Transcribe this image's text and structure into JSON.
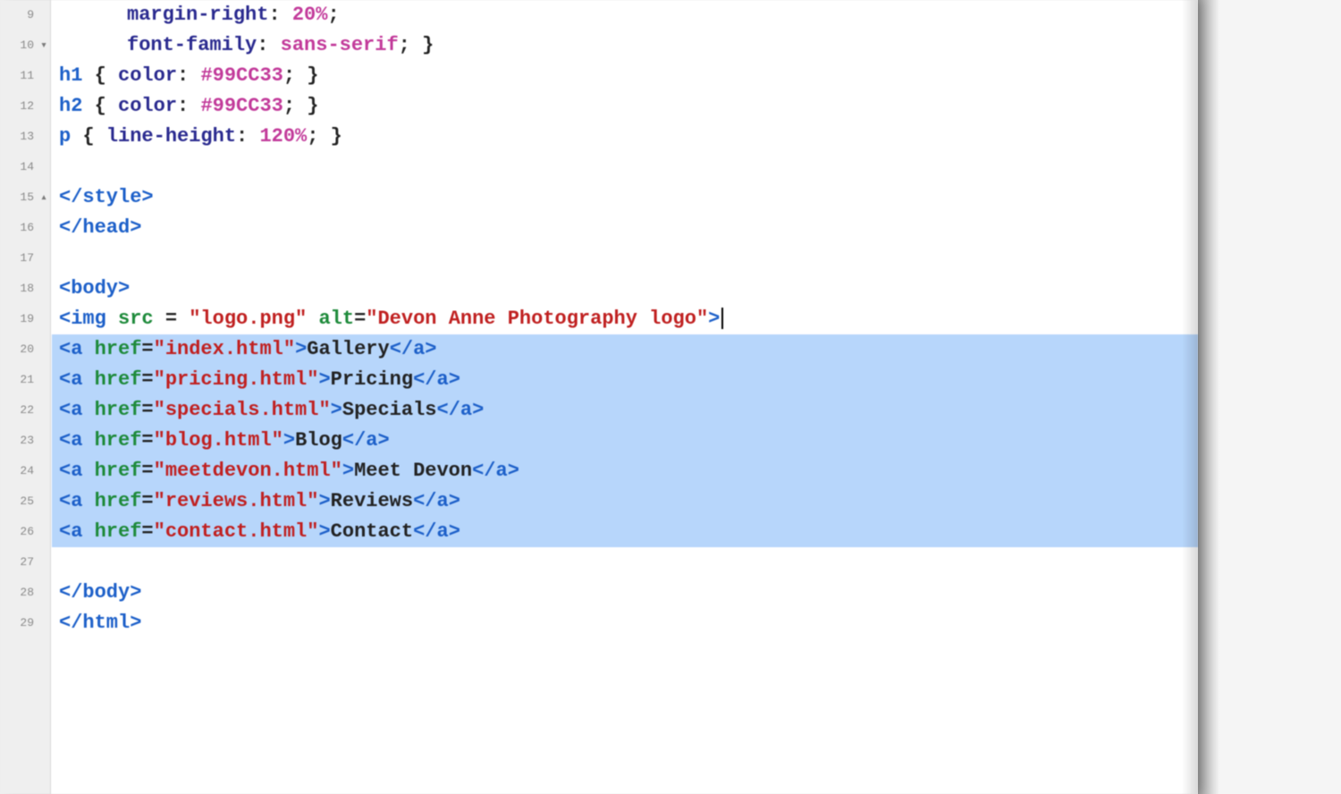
{
  "editor": {
    "first_line_number": 9,
    "fold_markers": {
      "10": "▾",
      "15": "▴"
    },
    "selection_start": 20,
    "selection_end": 26,
    "cursor_line": 19,
    "lines": [
      {
        "n": 9,
        "indent": 1,
        "tokens": [
          {
            "cls": "tok-prop",
            "t": "margin-right"
          },
          {
            "cls": "tok-plain",
            "t": ": "
          },
          {
            "cls": "tok-val",
            "t": "20%"
          },
          {
            "cls": "tok-plain",
            "t": ";"
          }
        ]
      },
      {
        "n": 10,
        "indent": 1,
        "tokens": [
          {
            "cls": "tok-prop",
            "t": "font-family"
          },
          {
            "cls": "tok-plain",
            "t": ": "
          },
          {
            "cls": "tok-val",
            "t": "sans-serif"
          },
          {
            "cls": "tok-plain",
            "t": "; }"
          }
        ]
      },
      {
        "n": 11,
        "indent": 0,
        "tokens": [
          {
            "cls": "tok-tag",
            "t": "h1"
          },
          {
            "cls": "tok-plain",
            "t": " { "
          },
          {
            "cls": "tok-prop",
            "t": "color"
          },
          {
            "cls": "tok-plain",
            "t": ": "
          },
          {
            "cls": "tok-val",
            "t": "#99CC33"
          },
          {
            "cls": "tok-plain",
            "t": "; }"
          }
        ]
      },
      {
        "n": 12,
        "indent": 0,
        "tokens": [
          {
            "cls": "tok-tag",
            "t": "h2"
          },
          {
            "cls": "tok-plain",
            "t": " { "
          },
          {
            "cls": "tok-prop",
            "t": "color"
          },
          {
            "cls": "tok-plain",
            "t": ": "
          },
          {
            "cls": "tok-val",
            "t": "#99CC33"
          },
          {
            "cls": "tok-plain",
            "t": "; }"
          }
        ]
      },
      {
        "n": 13,
        "indent": 0,
        "tokens": [
          {
            "cls": "tok-tag",
            "t": "p"
          },
          {
            "cls": "tok-plain",
            "t": " { "
          },
          {
            "cls": "tok-prop",
            "t": "line-height"
          },
          {
            "cls": "tok-plain",
            "t": ": "
          },
          {
            "cls": "tok-val",
            "t": "120%"
          },
          {
            "cls": "tok-plain",
            "t": "; }"
          }
        ]
      },
      {
        "n": 14,
        "indent": 0,
        "tokens": []
      },
      {
        "n": 15,
        "indent": 0,
        "tokens": [
          {
            "cls": "tok-tag",
            "t": "</style>"
          }
        ]
      },
      {
        "n": 16,
        "indent": 0,
        "tokens": [
          {
            "cls": "tok-tag",
            "t": "</head>"
          }
        ]
      },
      {
        "n": 17,
        "indent": 0,
        "tokens": []
      },
      {
        "n": 18,
        "indent": 0,
        "tokens": [
          {
            "cls": "tok-tag",
            "t": "<body>"
          }
        ]
      },
      {
        "n": 19,
        "indent": 0,
        "cursor_after": true,
        "tokens": [
          {
            "cls": "tok-tag",
            "t": "<img "
          },
          {
            "cls": "tok-attr",
            "t": "src"
          },
          {
            "cls": "tok-plain",
            "t": " = "
          },
          {
            "cls": "tok-str",
            "t": "\"logo.png\""
          },
          {
            "cls": "tok-plain",
            "t": " "
          },
          {
            "cls": "tok-attr",
            "t": "alt"
          },
          {
            "cls": "tok-plain",
            "t": "="
          },
          {
            "cls": "tok-str",
            "t": "\"Devon Anne Photography logo\""
          },
          {
            "cls": "tok-tag",
            "t": ">"
          }
        ]
      },
      {
        "n": 20,
        "indent": 0,
        "tokens": [
          {
            "cls": "tok-tag",
            "t": "<a "
          },
          {
            "cls": "tok-attr",
            "t": "href"
          },
          {
            "cls": "tok-plain",
            "t": "="
          },
          {
            "cls": "tok-str",
            "t": "\"index.html\""
          },
          {
            "cls": "tok-tag",
            "t": ">"
          },
          {
            "cls": "tok-plain",
            "t": "Gallery"
          },
          {
            "cls": "tok-tag",
            "t": "</a>"
          }
        ]
      },
      {
        "n": 21,
        "indent": 0,
        "tokens": [
          {
            "cls": "tok-tag",
            "t": "<a "
          },
          {
            "cls": "tok-attr",
            "t": "href"
          },
          {
            "cls": "tok-plain",
            "t": "="
          },
          {
            "cls": "tok-str",
            "t": "\"pricing.html\""
          },
          {
            "cls": "tok-tag",
            "t": ">"
          },
          {
            "cls": "tok-plain",
            "t": "Pricing"
          },
          {
            "cls": "tok-tag",
            "t": "</a>"
          }
        ]
      },
      {
        "n": 22,
        "indent": 0,
        "tokens": [
          {
            "cls": "tok-tag",
            "t": "<a "
          },
          {
            "cls": "tok-attr",
            "t": "href"
          },
          {
            "cls": "tok-plain",
            "t": "="
          },
          {
            "cls": "tok-str",
            "t": "\"specials.html\""
          },
          {
            "cls": "tok-tag",
            "t": ">"
          },
          {
            "cls": "tok-plain",
            "t": "Specials"
          },
          {
            "cls": "tok-tag",
            "t": "</a>"
          }
        ]
      },
      {
        "n": 23,
        "indent": 0,
        "tokens": [
          {
            "cls": "tok-tag",
            "t": "<a "
          },
          {
            "cls": "tok-attr",
            "t": "href"
          },
          {
            "cls": "tok-plain",
            "t": "="
          },
          {
            "cls": "tok-str",
            "t": "\"blog.html\""
          },
          {
            "cls": "tok-tag",
            "t": ">"
          },
          {
            "cls": "tok-plain",
            "t": "Blog"
          },
          {
            "cls": "tok-tag",
            "t": "</a>"
          }
        ]
      },
      {
        "n": 24,
        "indent": 0,
        "tokens": [
          {
            "cls": "tok-tag",
            "t": "<a "
          },
          {
            "cls": "tok-attr",
            "t": "href"
          },
          {
            "cls": "tok-plain",
            "t": "="
          },
          {
            "cls": "tok-str",
            "t": "\"meetdevon.html\""
          },
          {
            "cls": "tok-tag",
            "t": ">"
          },
          {
            "cls": "tok-plain",
            "t": "Meet Devon"
          },
          {
            "cls": "tok-tag",
            "t": "</a>"
          }
        ]
      },
      {
        "n": 25,
        "indent": 0,
        "tokens": [
          {
            "cls": "tok-tag",
            "t": "<a "
          },
          {
            "cls": "tok-attr",
            "t": "href"
          },
          {
            "cls": "tok-plain",
            "t": "="
          },
          {
            "cls": "tok-str",
            "t": "\"reviews.html\""
          },
          {
            "cls": "tok-tag",
            "t": ">"
          },
          {
            "cls": "tok-plain",
            "t": "Reviews"
          },
          {
            "cls": "tok-tag",
            "t": "</a>"
          }
        ]
      },
      {
        "n": 26,
        "indent": 0,
        "tokens": [
          {
            "cls": "tok-tag",
            "t": "<a "
          },
          {
            "cls": "tok-attr",
            "t": "href"
          },
          {
            "cls": "tok-plain",
            "t": "="
          },
          {
            "cls": "tok-str",
            "t": "\"contact.html\""
          },
          {
            "cls": "tok-tag",
            "t": ">"
          },
          {
            "cls": "tok-plain",
            "t": "Contact"
          },
          {
            "cls": "tok-tag",
            "t": "</a>"
          }
        ]
      },
      {
        "n": 27,
        "indent": 0,
        "tokens": []
      },
      {
        "n": 28,
        "indent": 0,
        "tokens": [
          {
            "cls": "tok-tag",
            "t": "</body>"
          }
        ]
      },
      {
        "n": 29,
        "indent": 0,
        "tokens": [
          {
            "cls": "tok-tag",
            "t": "</html>"
          }
        ]
      }
    ]
  }
}
